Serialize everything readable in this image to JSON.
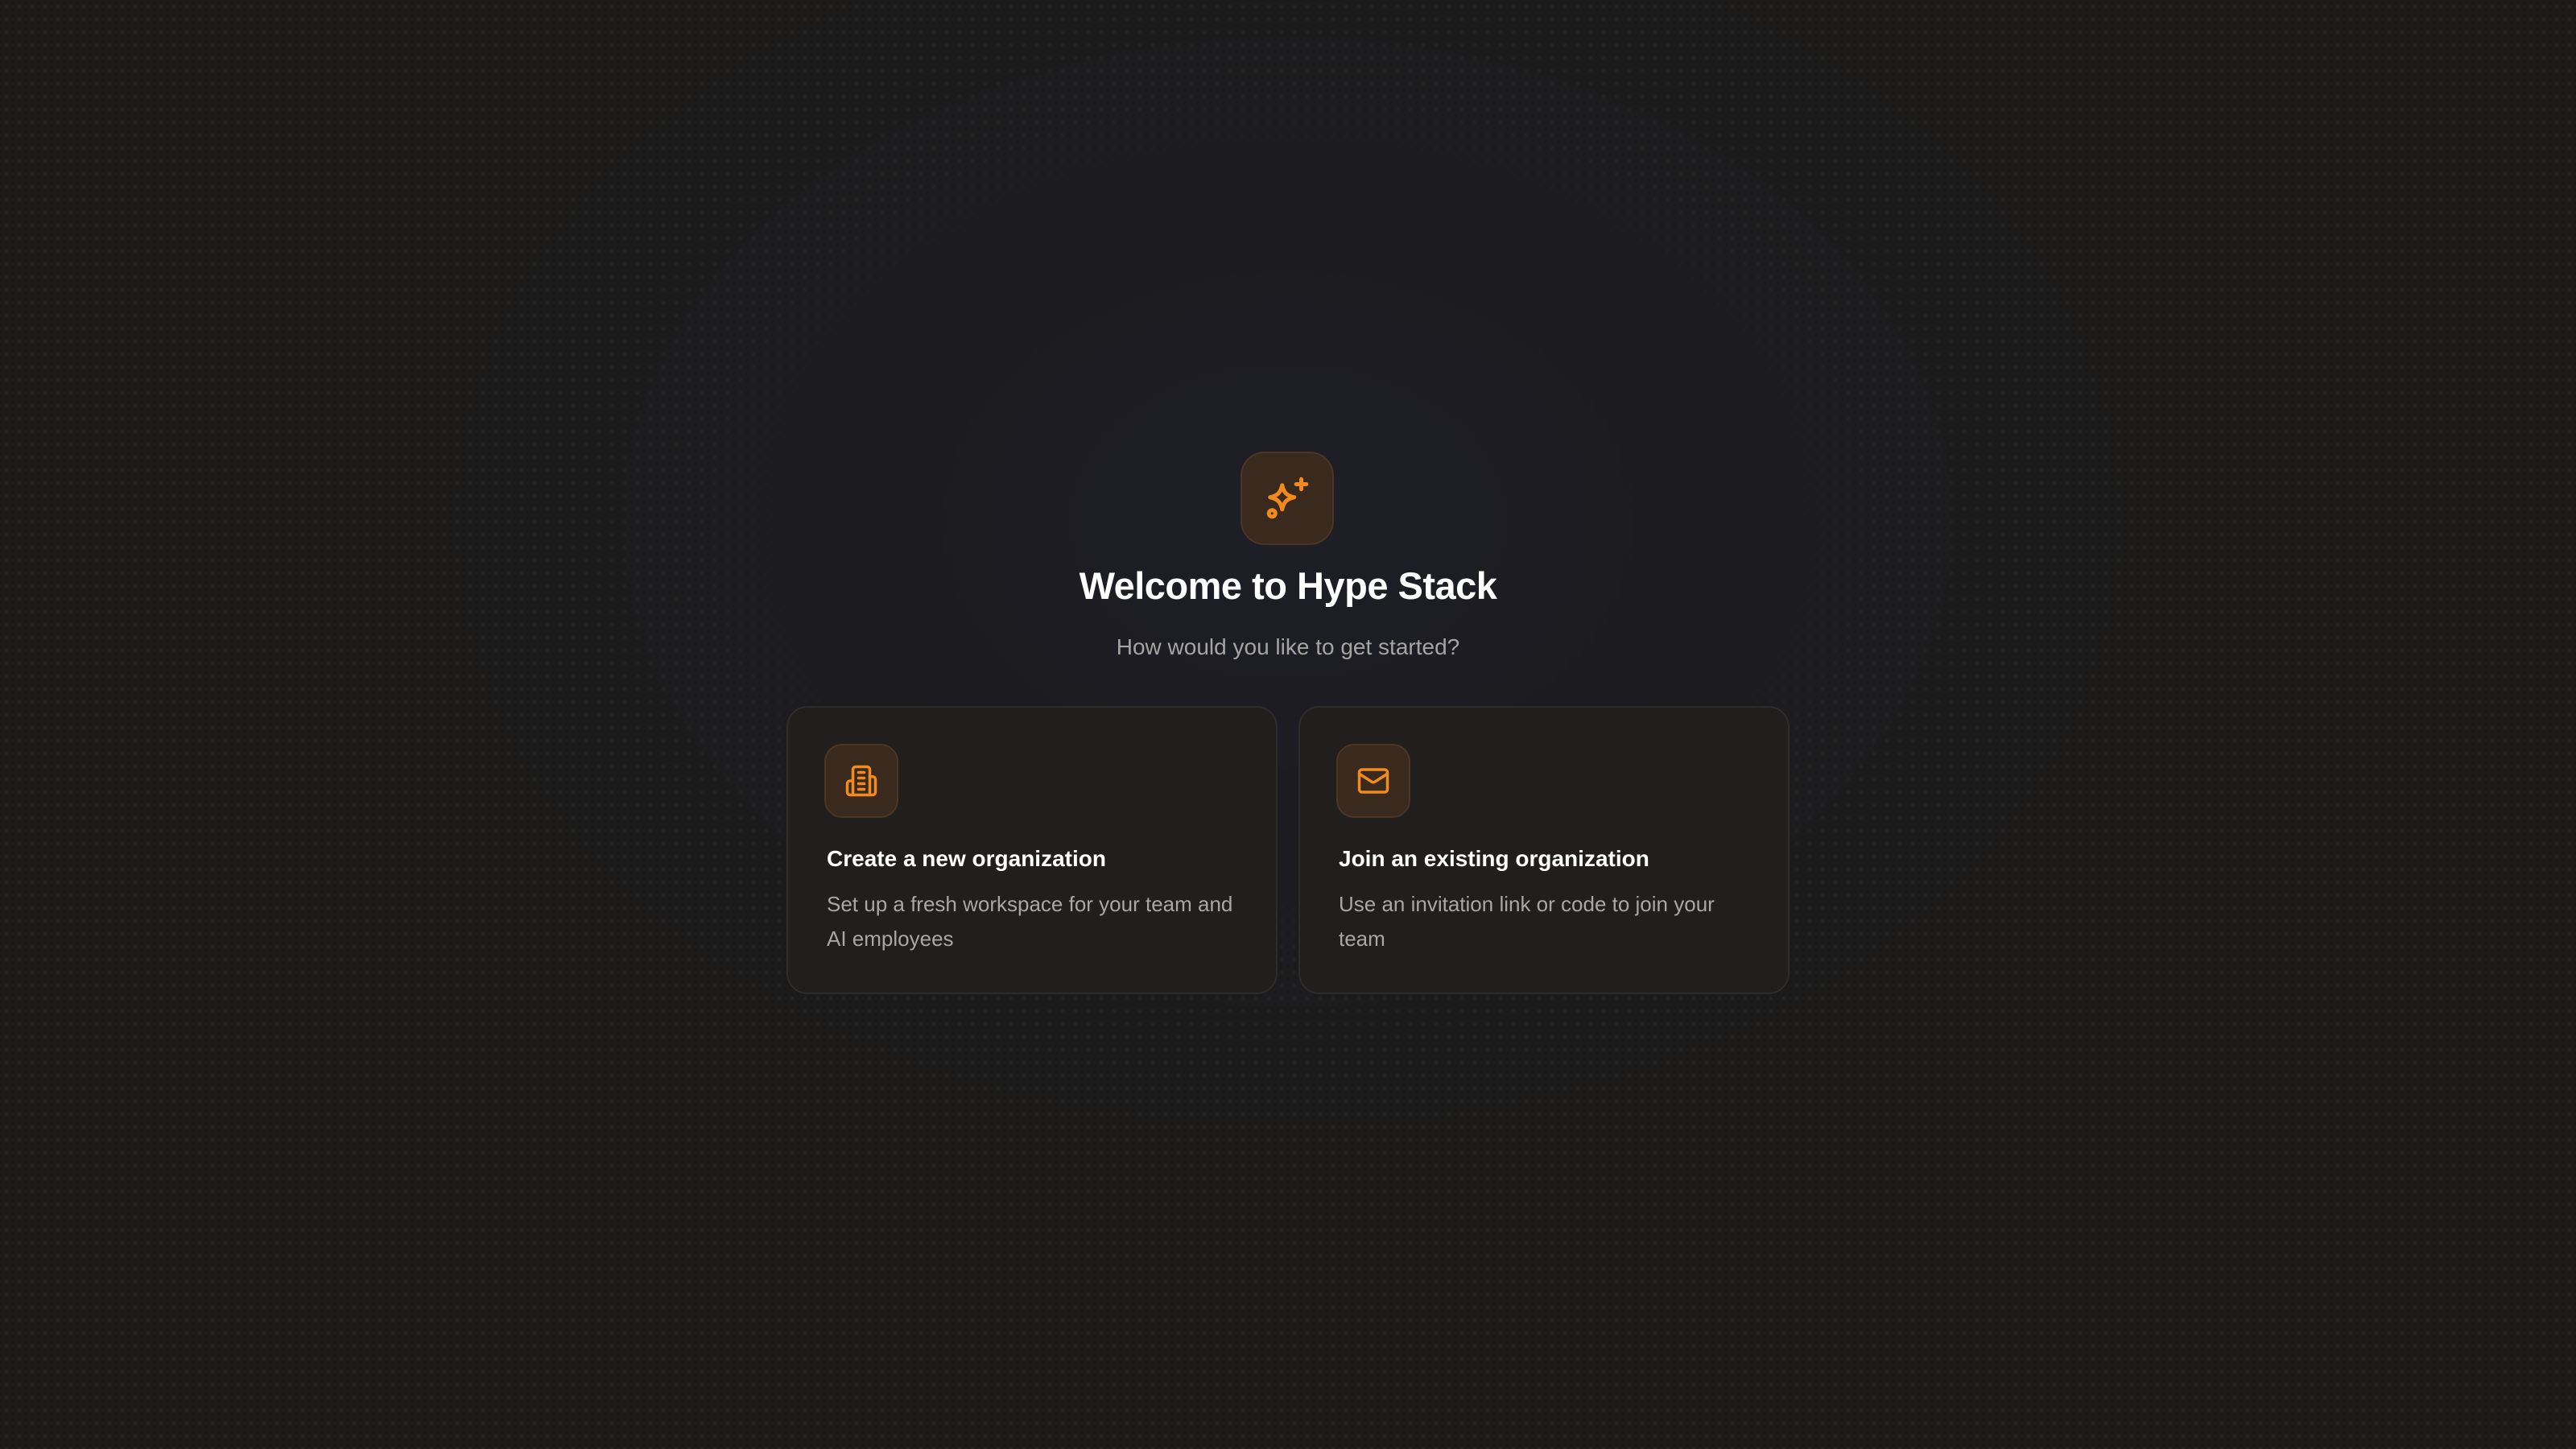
{
  "welcome": {
    "title": "Welcome to Hype Stack",
    "subtitle": "How would you like to get started?",
    "logo_icon": "sparkles-icon"
  },
  "options": [
    {
      "title": "Create a new organization",
      "description": "Set up a fresh workspace for your team and AI employees",
      "icon": "building-icon"
    },
    {
      "title": "Join an existing organization",
      "description": "Use an invitation link or code to join your team",
      "icon": "mail-icon"
    }
  ],
  "colors": {
    "accent": "#f28a1e",
    "background": "#1c1b1a",
    "card_background": "#201f1e",
    "icon_tile": "#3a2a1e"
  }
}
